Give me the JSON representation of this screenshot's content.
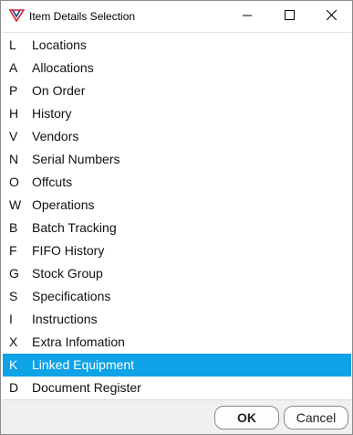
{
  "window": {
    "title": "Item Details Selection",
    "icon": "app-logo-icon",
    "controls": [
      "minimize-icon",
      "maximize-icon",
      "close-icon"
    ]
  },
  "items": [
    {
      "key": "L",
      "label": "Locations"
    },
    {
      "key": "A",
      "label": "Allocations"
    },
    {
      "key": "P",
      "label": "On Order"
    },
    {
      "key": "H",
      "label": "History"
    },
    {
      "key": "V",
      "label": "Vendors"
    },
    {
      "key": "N",
      "label": "Serial Numbers"
    },
    {
      "key": "O",
      "label": "Offcuts"
    },
    {
      "key": "W",
      "label": "Operations"
    },
    {
      "key": "B",
      "label": "Batch Tracking"
    },
    {
      "key": "F",
      "label": "FIFO History"
    },
    {
      "key": "G",
      "label": "Stock Group"
    },
    {
      "key": "S",
      "label": "Specifications"
    },
    {
      "key": "I",
      "label": "Instructions"
    },
    {
      "key": "X",
      "label": "Extra Infomation"
    },
    {
      "key": "K",
      "label": "Linked Equipment"
    },
    {
      "key": "D",
      "label": "Document Register"
    }
  ],
  "selected_label": "Linked Equipment",
  "buttons": {
    "ok": "OK",
    "cancel": "Cancel"
  },
  "colors": {
    "selection": "#0ea2e6",
    "logo_red": "#d9262e",
    "logo_blue": "#1f3f8f"
  }
}
